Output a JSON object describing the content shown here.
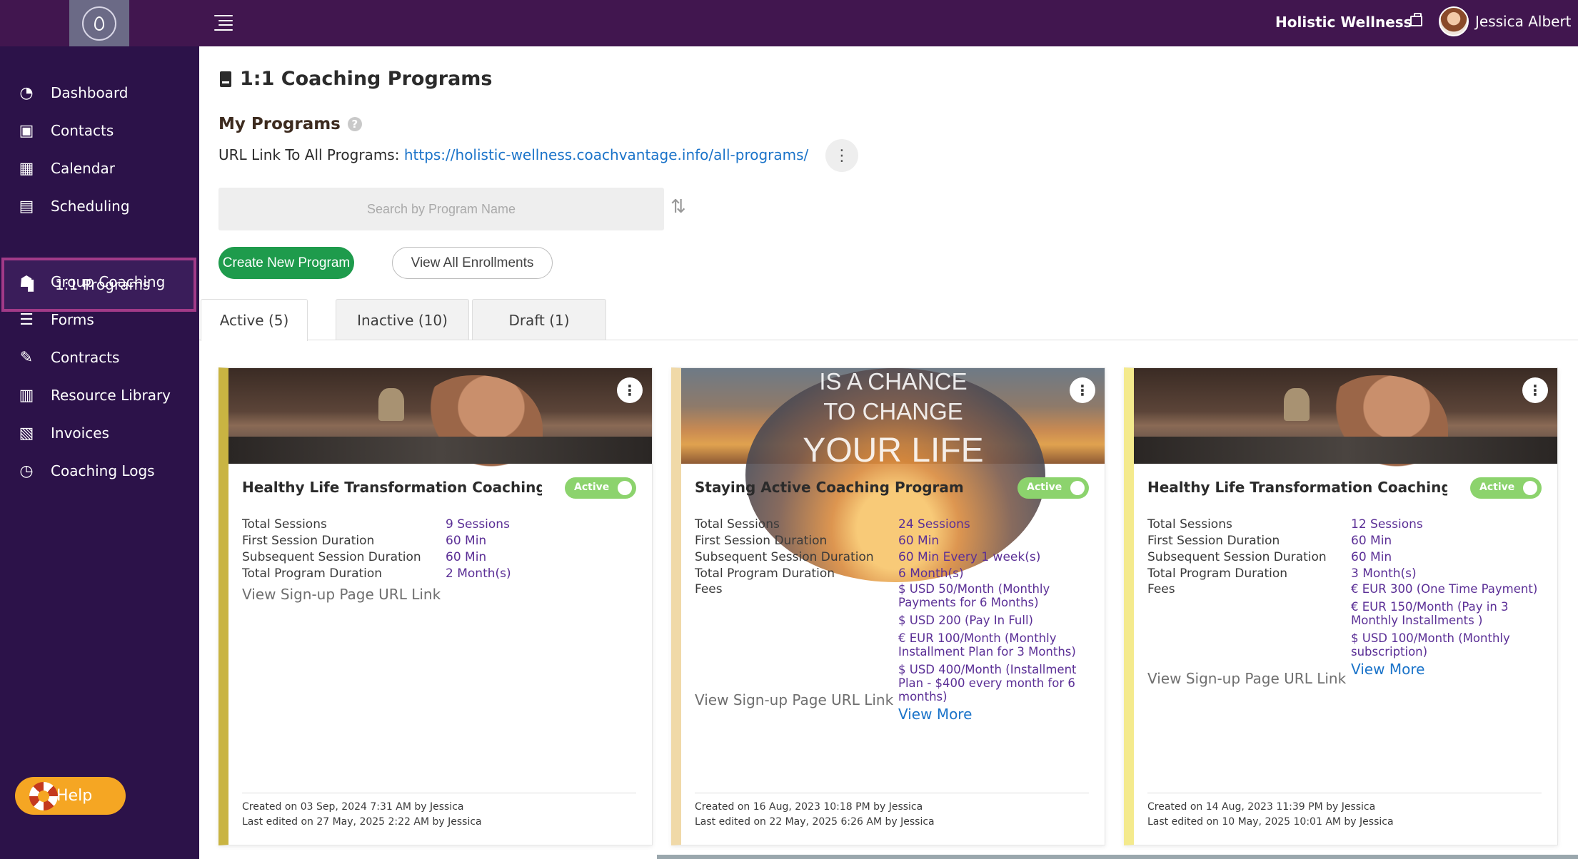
{
  "topbar": {
    "brand": "Holistic Wellness",
    "user_name": "Jessica Albert"
  },
  "sidebar": {
    "items": [
      {
        "label": "Dashboard",
        "icon": "dashboard-icon"
      },
      {
        "label": "Contacts",
        "icon": "contacts-icon"
      },
      {
        "label": "Calendar",
        "icon": "calendar-icon"
      },
      {
        "label": "Scheduling",
        "icon": "scheduling-icon"
      },
      {
        "label": "1:1 Programs",
        "icon": "book-icon",
        "active": true
      },
      {
        "label": "Group Coaching",
        "icon": "group-icon"
      },
      {
        "label": "Forms",
        "icon": "forms-icon"
      },
      {
        "label": "Contracts",
        "icon": "contract-icon"
      },
      {
        "label": "Resource Library",
        "icon": "library-icon"
      },
      {
        "label": "Invoices",
        "icon": "invoice-icon"
      },
      {
        "label": "Coaching Logs",
        "icon": "clock-icon"
      }
    ],
    "help_label": "Help"
  },
  "main": {
    "page_title": "1:1 Coaching Programs",
    "section_title": "My Programs",
    "url_label": "URL Link To All Programs: ",
    "url": "https://holistic-wellness.coachvantage.info/all-programs/",
    "search_placeholder": "Search by Program Name",
    "create_button": "Create New Program",
    "view_enrollments_button": "View All Enrollments",
    "tabs": [
      {
        "label": "Active (5)",
        "active": true
      },
      {
        "label": "Inactive (10)"
      },
      {
        "label": "Draft (1)"
      }
    ]
  },
  "cards": [
    {
      "image_text": [],
      "title": "Healthy Life Transformation Coaching - ...",
      "status": "Active",
      "rows": [
        {
          "label": "Total Sessions",
          "value": "9 Sessions"
        },
        {
          "label": "First Session Duration",
          "value": "60 Min"
        },
        {
          "label": "Subsequent Session Duration",
          "value": "60 Min"
        },
        {
          "label": "Total Program Duration",
          "value": "2 Month(s)"
        }
      ],
      "fees_label": "",
      "fees": [],
      "view_more": "",
      "signup": "View Sign-up Page URL Link",
      "created": "Created on 03 Sep, 2024 7:31 AM by Jessica",
      "edited": "Last edited on 27 May, 2025 2:22 AM by Jessica"
    },
    {
      "image_text": [
        "IS A CHANCE",
        "TO CHANGE",
        "YOUR LIFE"
      ],
      "title": "Staying Active Coaching Program",
      "status": "Active",
      "rows": [
        {
          "label": "Total Sessions",
          "value": "24 Sessions"
        },
        {
          "label": "First Session Duration",
          "value": "60 Min"
        },
        {
          "label": "Subsequent Session Duration",
          "value": "60 Min Every 1 week(s)"
        },
        {
          "label": "Total Program Duration",
          "value": "6 Month(s)"
        }
      ],
      "fees_label": "Fees",
      "fees": [
        "$ USD 50/Month (Monthly Payments for 6 Months)",
        "$ USD 200 (Pay In Full)",
        "€ EUR 100/Month (Monthly Installment Plan for 3 Months)",
        "$ USD 400/Month (Installment Plan - $400 every month for 6 months)"
      ],
      "view_more": "View More",
      "signup": "View Sign-up Page URL Link",
      "created": "Created on 16 Aug, 2023 10:18 PM by Jessica",
      "edited": "Last edited on 22 May, 2025 6:26 AM by Jessica"
    },
    {
      "image_text": [],
      "title": "Healthy Life Transformation Coaching",
      "status": "Active",
      "rows": [
        {
          "label": "Total Sessions",
          "value": "12 Sessions"
        },
        {
          "label": "First Session Duration",
          "value": "60 Min"
        },
        {
          "label": "Subsequent Session Duration",
          "value": "60 Min"
        },
        {
          "label": "Total Program Duration",
          "value": "3 Month(s)"
        }
      ],
      "fees_label": "Fees",
      "fees": [
        "€ EUR 300 (One Time Payment)",
        "€ EUR 150/Month (Pay in 3 Monthly Installments )",
        "$ USD 100/Month (Monthly subscription)"
      ],
      "view_more": "View More",
      "signup": "View Sign-up Page URL Link",
      "created": "Created on 14 Aug, 2023 11:39 PM by Jessica",
      "edited": "Last edited on 10 May, 2025 10:01 AM by Jessica"
    }
  ],
  "colors": {
    "topbar": "#41164f",
    "sidebar": "#2c1249",
    "active_border": "#a23a88",
    "create_button": "#1e9b4c",
    "link": "#1a73c9",
    "value_text": "#5b2f96",
    "toggle_on": "#8cd36d",
    "help": "#f5a623"
  }
}
